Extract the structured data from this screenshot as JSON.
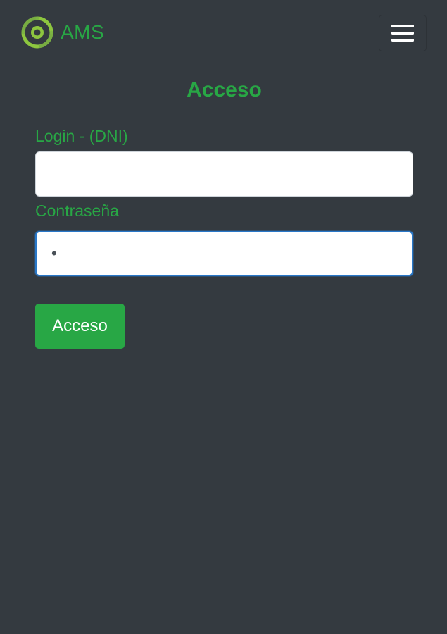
{
  "colors": {
    "background": "#343a40",
    "accent_green": "#28a745",
    "logo_green": "#8dc63f",
    "input_focus": "#2a78c8"
  },
  "navbar": {
    "brand_name": "AMS",
    "brand_icon": "ams-logo-icon",
    "menu_icon": "hamburger-menu-icon"
  },
  "login_form": {
    "title": "Acceso",
    "login_label": "Login - (DNI)",
    "login_value": "",
    "password_label": "Contraseña",
    "password_value": "•",
    "submit_label": "Acceso"
  }
}
